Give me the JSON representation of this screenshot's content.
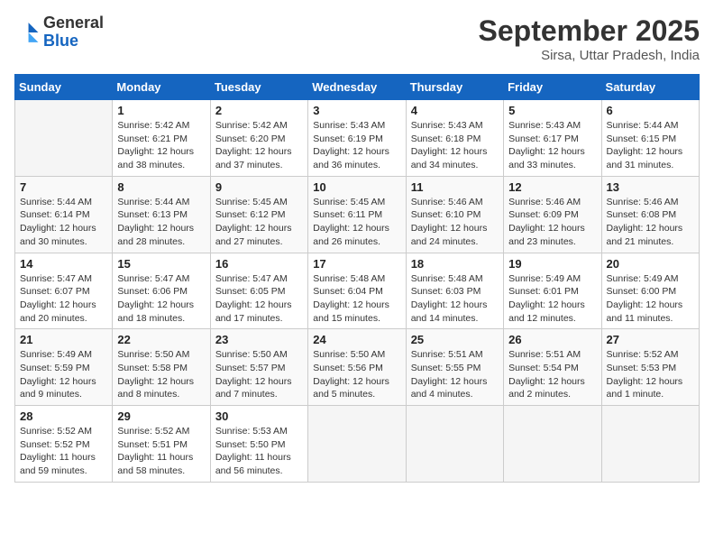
{
  "logo": {
    "general": "General",
    "blue": "Blue"
  },
  "header": {
    "month": "September 2025",
    "location": "Sirsa, Uttar Pradesh, India"
  },
  "weekdays": [
    "Sunday",
    "Monday",
    "Tuesday",
    "Wednesday",
    "Thursday",
    "Friday",
    "Saturday"
  ],
  "weeks": [
    [
      {
        "day": "",
        "info": ""
      },
      {
        "day": "1",
        "info": "Sunrise: 5:42 AM\nSunset: 6:21 PM\nDaylight: 12 hours\nand 38 minutes."
      },
      {
        "day": "2",
        "info": "Sunrise: 5:42 AM\nSunset: 6:20 PM\nDaylight: 12 hours\nand 37 minutes."
      },
      {
        "day": "3",
        "info": "Sunrise: 5:43 AM\nSunset: 6:19 PM\nDaylight: 12 hours\nand 36 minutes."
      },
      {
        "day": "4",
        "info": "Sunrise: 5:43 AM\nSunset: 6:18 PM\nDaylight: 12 hours\nand 34 minutes."
      },
      {
        "day": "5",
        "info": "Sunrise: 5:43 AM\nSunset: 6:17 PM\nDaylight: 12 hours\nand 33 minutes."
      },
      {
        "day": "6",
        "info": "Sunrise: 5:44 AM\nSunset: 6:15 PM\nDaylight: 12 hours\nand 31 minutes."
      }
    ],
    [
      {
        "day": "7",
        "info": "Sunrise: 5:44 AM\nSunset: 6:14 PM\nDaylight: 12 hours\nand 30 minutes."
      },
      {
        "day": "8",
        "info": "Sunrise: 5:44 AM\nSunset: 6:13 PM\nDaylight: 12 hours\nand 28 minutes."
      },
      {
        "day": "9",
        "info": "Sunrise: 5:45 AM\nSunset: 6:12 PM\nDaylight: 12 hours\nand 27 minutes."
      },
      {
        "day": "10",
        "info": "Sunrise: 5:45 AM\nSunset: 6:11 PM\nDaylight: 12 hours\nand 26 minutes."
      },
      {
        "day": "11",
        "info": "Sunrise: 5:46 AM\nSunset: 6:10 PM\nDaylight: 12 hours\nand 24 minutes."
      },
      {
        "day": "12",
        "info": "Sunrise: 5:46 AM\nSunset: 6:09 PM\nDaylight: 12 hours\nand 23 minutes."
      },
      {
        "day": "13",
        "info": "Sunrise: 5:46 AM\nSunset: 6:08 PM\nDaylight: 12 hours\nand 21 minutes."
      }
    ],
    [
      {
        "day": "14",
        "info": "Sunrise: 5:47 AM\nSunset: 6:07 PM\nDaylight: 12 hours\nand 20 minutes."
      },
      {
        "day": "15",
        "info": "Sunrise: 5:47 AM\nSunset: 6:06 PM\nDaylight: 12 hours\nand 18 minutes."
      },
      {
        "day": "16",
        "info": "Sunrise: 5:47 AM\nSunset: 6:05 PM\nDaylight: 12 hours\nand 17 minutes."
      },
      {
        "day": "17",
        "info": "Sunrise: 5:48 AM\nSunset: 6:04 PM\nDaylight: 12 hours\nand 15 minutes."
      },
      {
        "day": "18",
        "info": "Sunrise: 5:48 AM\nSunset: 6:03 PM\nDaylight: 12 hours\nand 14 minutes."
      },
      {
        "day": "19",
        "info": "Sunrise: 5:49 AM\nSunset: 6:01 PM\nDaylight: 12 hours\nand 12 minutes."
      },
      {
        "day": "20",
        "info": "Sunrise: 5:49 AM\nSunset: 6:00 PM\nDaylight: 12 hours\nand 11 minutes."
      }
    ],
    [
      {
        "day": "21",
        "info": "Sunrise: 5:49 AM\nSunset: 5:59 PM\nDaylight: 12 hours\nand 9 minutes."
      },
      {
        "day": "22",
        "info": "Sunrise: 5:50 AM\nSunset: 5:58 PM\nDaylight: 12 hours\nand 8 minutes."
      },
      {
        "day": "23",
        "info": "Sunrise: 5:50 AM\nSunset: 5:57 PM\nDaylight: 12 hours\nand 7 minutes."
      },
      {
        "day": "24",
        "info": "Sunrise: 5:50 AM\nSunset: 5:56 PM\nDaylight: 12 hours\nand 5 minutes."
      },
      {
        "day": "25",
        "info": "Sunrise: 5:51 AM\nSunset: 5:55 PM\nDaylight: 12 hours\nand 4 minutes."
      },
      {
        "day": "26",
        "info": "Sunrise: 5:51 AM\nSunset: 5:54 PM\nDaylight: 12 hours\nand 2 minutes."
      },
      {
        "day": "27",
        "info": "Sunrise: 5:52 AM\nSunset: 5:53 PM\nDaylight: 12 hours\nand 1 minute."
      }
    ],
    [
      {
        "day": "28",
        "info": "Sunrise: 5:52 AM\nSunset: 5:52 PM\nDaylight: 11 hours\nand 59 minutes."
      },
      {
        "day": "29",
        "info": "Sunrise: 5:52 AM\nSunset: 5:51 PM\nDaylight: 11 hours\nand 58 minutes."
      },
      {
        "day": "30",
        "info": "Sunrise: 5:53 AM\nSunset: 5:50 PM\nDaylight: 11 hours\nand 56 minutes."
      },
      {
        "day": "",
        "info": ""
      },
      {
        "day": "",
        "info": ""
      },
      {
        "day": "",
        "info": ""
      },
      {
        "day": "",
        "info": ""
      }
    ]
  ]
}
